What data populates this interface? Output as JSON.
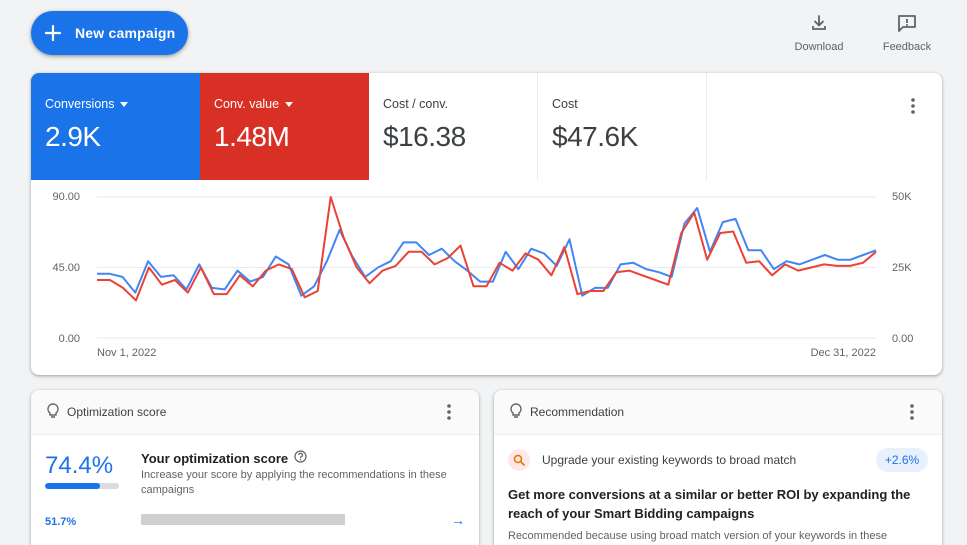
{
  "toolbar": {
    "new_campaign_label": "New campaign",
    "download_label": "Download",
    "feedback_label": "Feedback"
  },
  "metrics": [
    {
      "name": "Conversions",
      "value": "2.9K",
      "color": "#1a73e8"
    },
    {
      "name": "Conv. value",
      "value": "1.48M",
      "color": "#d93025"
    },
    {
      "name": "Cost / conv.",
      "value": "$16.38"
    },
    {
      "name": "Cost",
      "value": "$47.6K"
    }
  ],
  "chart_data": {
    "type": "line",
    "x_start_label": "Nov 1, 2022",
    "x_end_label": "Dec 31, 2022",
    "y_left": {
      "ticks": [
        "0.00",
        "45.00",
        "90.00"
      ],
      "range": [
        0,
        90
      ]
    },
    "y_right": {
      "ticks": [
        "0.00",
        "25K",
        "50K"
      ],
      "range": [
        0,
        50000
      ]
    },
    "series": [
      {
        "color": "#4285f4",
        "values": [
          41,
          41,
          39,
          29,
          49,
          39,
          40,
          31,
          47,
          32,
          31,
          43,
          36,
          39,
          52,
          47,
          27,
          33,
          49,
          69,
          52,
          39,
          45,
          49,
          61,
          61,
          53,
          57,
          49,
          43,
          36,
          36,
          55,
          44,
          57,
          54,
          46,
          63,
          27,
          32,
          32,
          47,
          48,
          44,
          42,
          39,
          73,
          83,
          55,
          74,
          76,
          56,
          56,
          44,
          49,
          47,
          50,
          53,
          50,
          50,
          53,
          56
        ],
        "name": ""
      },
      {
        "color": "#ea4335",
        "values": [
          37,
          37,
          32,
          24,
          45,
          34,
          37,
          29,
          45,
          28,
          28,
          40,
          33,
          43,
          47,
          44,
          26,
          30,
          90,
          64,
          45,
          35,
          43,
          46,
          55,
          55,
          47,
          51,
          59,
          33,
          33,
          48,
          43,
          54,
          50,
          40,
          58,
          28,
          30,
          30,
          42,
          43,
          40,
          37,
          34,
          67,
          80,
          50,
          67,
          68,
          48,
          49,
          40,
          47,
          43,
          45,
          47,
          46,
          46,
          48,
          55
        ],
        "name": ""
      }
    ]
  },
  "optimization": {
    "title": "Optimization score",
    "score": "74.4%",
    "score_fraction": 0.744,
    "heading": "Your optimization score",
    "description": "Increase your score by applying the recommendations in these campaigns",
    "sub_value": "51.7%"
  },
  "recommendation": {
    "title": "Recommendation",
    "line": "Upgrade your existing keywords to broad match",
    "badge": "+2.6%",
    "heading": "Get more conversions at a similar or better ROI by expanding the reach of your Smart Bidding campaigns",
    "footer": "Recommended because using broad match version of your keywords in these"
  }
}
